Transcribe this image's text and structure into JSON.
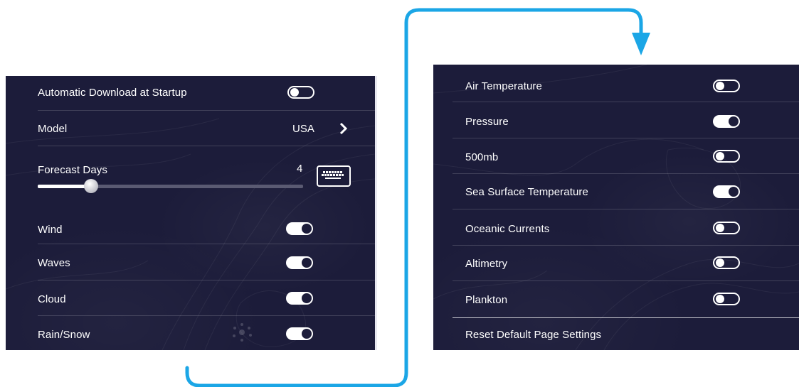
{
  "left_panel": {
    "rows": [
      {
        "label": "Automatic Download at Startup",
        "control": "toggle",
        "state": "off"
      },
      {
        "label": "Model",
        "control": "select",
        "value": "USA"
      },
      {
        "label": "Forecast Days",
        "control": "slider",
        "value": "4",
        "level": 0.2
      },
      {
        "label": "Wind",
        "control": "toggle",
        "state": "on"
      },
      {
        "label": "Waves",
        "control": "toggle",
        "state": "on"
      },
      {
        "label": "Cloud",
        "control": "toggle",
        "state": "on"
      },
      {
        "label": "Rain/Snow",
        "control": "toggle",
        "state": "on"
      }
    ]
  },
  "right_panel": {
    "rows": [
      {
        "label": "Air Temperature",
        "control": "toggle",
        "state": "off"
      },
      {
        "label": "Pressure",
        "control": "toggle",
        "state": "on"
      },
      {
        "label": "500mb",
        "control": "toggle",
        "state": "off"
      },
      {
        "label": "Sea Surface Temperature",
        "control": "toggle",
        "state": "on"
      },
      {
        "label": "Oceanic Currents",
        "control": "toggle",
        "state": "off"
      },
      {
        "label": "Altimetry",
        "control": "toggle",
        "state": "off"
      },
      {
        "label": "Plankton",
        "control": "toggle",
        "state": "off"
      },
      {
        "label": "Reset Default Page Settings",
        "control": "action"
      }
    ]
  },
  "colors": {
    "panel_bg": "#1c1c3a",
    "connector_arrow": "#1ba6e6",
    "text": "#ffffff"
  },
  "icons": {
    "chevron": "chevron-right-icon",
    "keyboard": "keyboard-icon",
    "connector": "flow-arrow"
  }
}
